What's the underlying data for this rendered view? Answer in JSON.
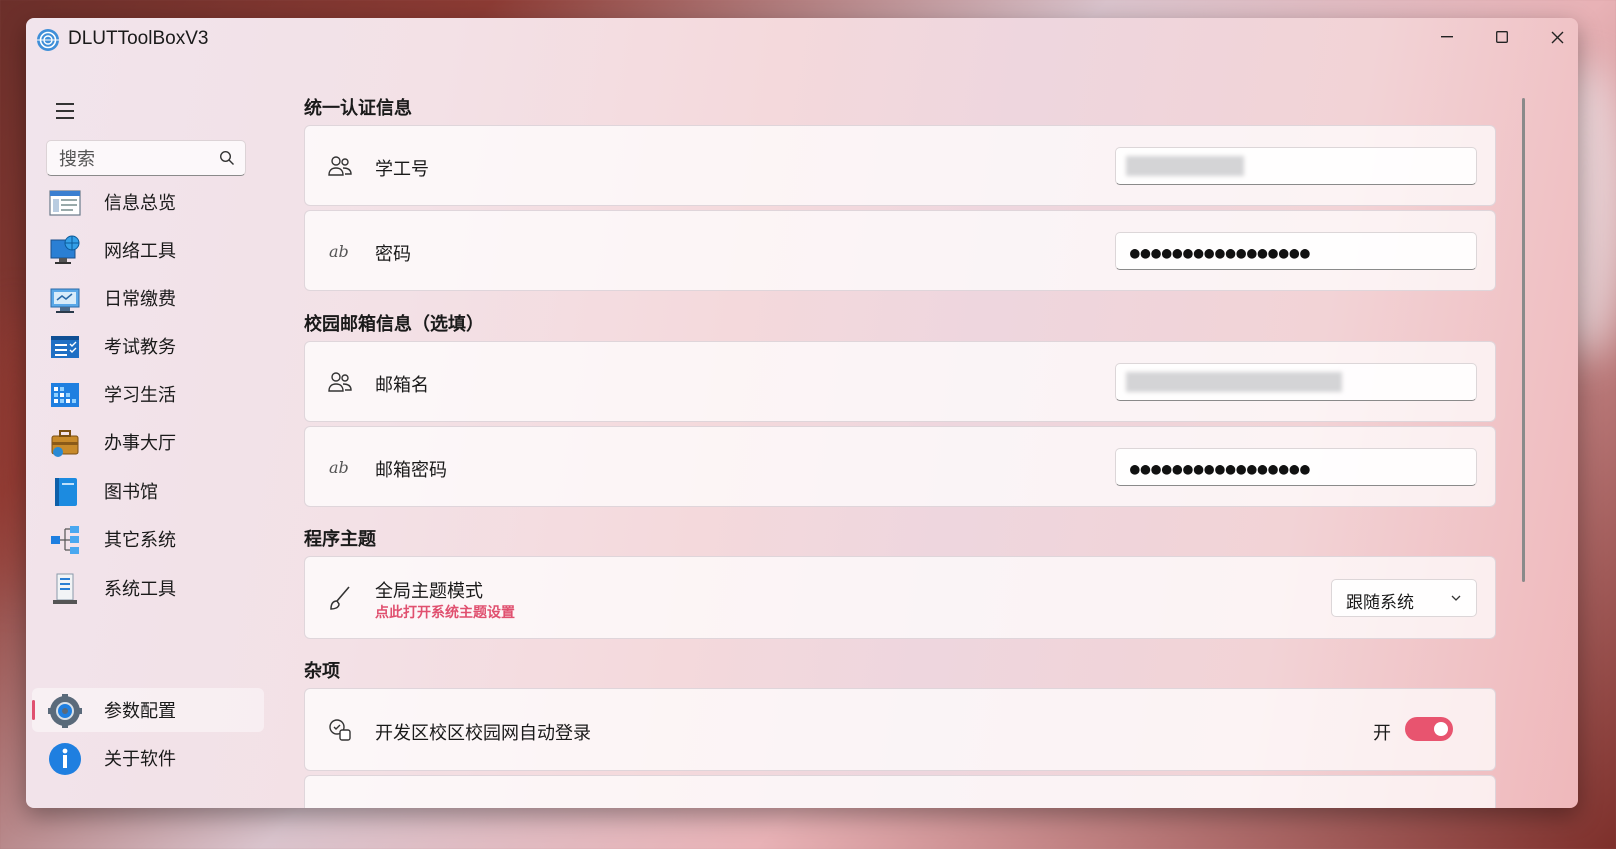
{
  "app": {
    "title": "DLUTToolBoxV3"
  },
  "window_controls": {
    "minimize": "—",
    "maximize": "☐",
    "close": "✕"
  },
  "search": {
    "placeholder": "搜索"
  },
  "nav": {
    "items": [
      {
        "label": "信息总览",
        "icon": "overview-icon"
      },
      {
        "label": "网络工具",
        "icon": "network-icon"
      },
      {
        "label": "日常缴费",
        "icon": "payment-icon"
      },
      {
        "label": "考试教务",
        "icon": "exam-icon"
      },
      {
        "label": "学习生活",
        "icon": "study-icon"
      },
      {
        "label": "办事大厅",
        "icon": "service-hall-icon"
      },
      {
        "label": "图书馆",
        "icon": "library-icon"
      },
      {
        "label": "其它系统",
        "icon": "other-systems-icon"
      },
      {
        "label": "系统工具",
        "icon": "system-tools-icon"
      }
    ],
    "footer": [
      {
        "label": "参数配置",
        "icon": "gear-icon",
        "selected": true
      },
      {
        "label": "关于软件",
        "icon": "info-icon"
      }
    ]
  },
  "sections": {
    "auth": {
      "title": "统一认证信息",
      "student_id": {
        "label": "学工号",
        "value": ""
      },
      "password": {
        "label": "密码",
        "value": "●●●●●●●●●●●●●●●●●"
      }
    },
    "mail": {
      "title": "校园邮箱信息（选填）",
      "mail_name": {
        "label": "邮箱名",
        "value": ""
      },
      "mail_password": {
        "label": "邮箱密码",
        "value": "●●●●●●●●●●●●●●●●●"
      }
    },
    "theme": {
      "title": "程序主题",
      "label": "全局主题模式",
      "link": "点此打开系统主题设置",
      "selected": "跟随系统"
    },
    "misc": {
      "title": "杂项",
      "autologin": {
        "label": "开发区校区校园网自动登录",
        "state_label": "开",
        "on": true
      }
    }
  },
  "colors": {
    "accent": "#e8546f",
    "link": "#e0506f"
  }
}
